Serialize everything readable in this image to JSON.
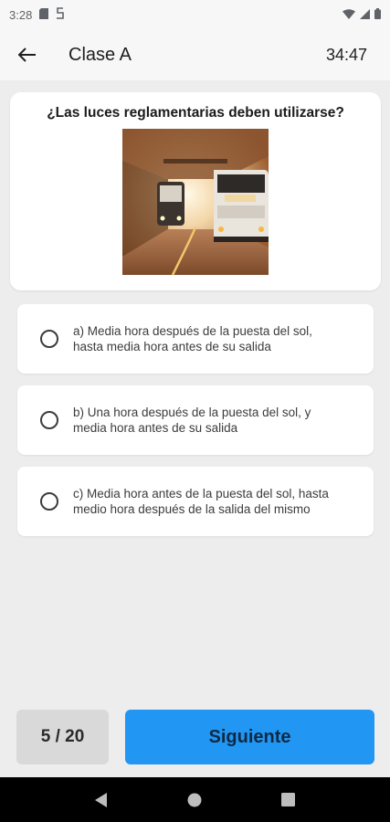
{
  "status_bar": {
    "time": "3:28",
    "icons": [
      "sd-card-icon",
      "s-logo-icon",
      "wifi-icon",
      "signal-icon",
      "battery-icon"
    ]
  },
  "app_bar": {
    "back_icon": "arrow-left-icon",
    "title": "Clase A",
    "timer": "34:47"
  },
  "question": {
    "text": "¿Las luces reglamentarias deben utilizarse?",
    "image_subject": "buses-in-tunnel-photo"
  },
  "options": [
    {
      "line1": "a) Media hora después de la puesta del sol,",
      "line2": "hasta media hora antes de su salida",
      "selected": false
    },
    {
      "line1": "b) Una hora después de la puesta del sol, y",
      "line2": "media hora antes de su salida",
      "selected": false
    },
    {
      "line1": "c) Media hora antes de la puesta del sol, hasta",
      "line2": "medio hora después de la salida del mismo",
      "selected": false
    }
  ],
  "footer": {
    "counter": "5 / 20",
    "next_label": "Siguiente"
  },
  "nav": {
    "icons": [
      "nav-back-icon",
      "nav-home-icon",
      "nav-recents-icon"
    ]
  },
  "colors": {
    "accent": "#2196f3",
    "background": "#ededed",
    "card": "#ffffff",
    "counter_bg": "#d9d9d9"
  }
}
